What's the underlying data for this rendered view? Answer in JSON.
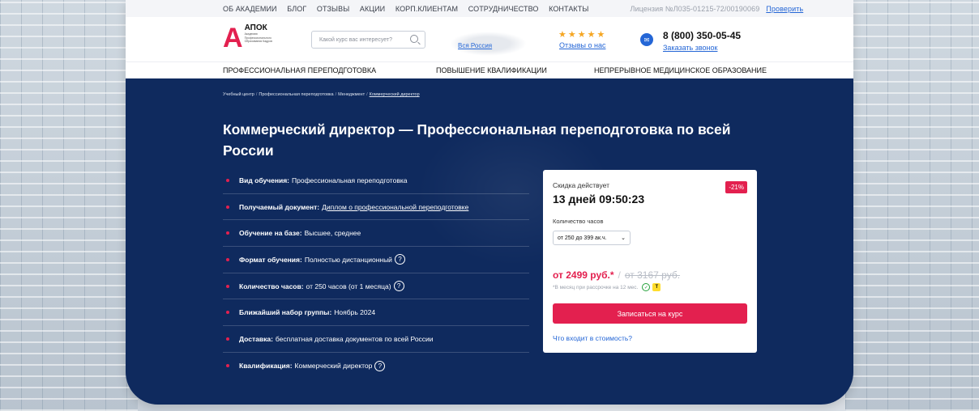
{
  "topbar": {
    "nav": [
      "ОБ АКАДЕМИИ",
      "БЛОГ",
      "ОТЗЫВЫ",
      "АКЦИИ",
      "КОРП.КЛИЕНТАМ",
      "СОТРУДНИЧЕСТВО",
      "КОНТАКТЫ"
    ],
    "license": "Лицензия №Л035-01215-72/00190069",
    "verify_label": "Проверить"
  },
  "header": {
    "logo_letter": "А",
    "logo_name": "АПОК",
    "logo_sub": "Академия Профессионального Образования Кадров",
    "search_placeholder": "Какой курс вас интересует?",
    "region": "Вся Россия",
    "stars": "★★★★★",
    "reviews_label": "Отзывы о нас",
    "phone": "8 (800) 350-05-45",
    "callback_label": "Заказать звонок"
  },
  "mainnav": {
    "items": [
      "ПРОФЕССИОНАЛЬНАЯ ПЕРЕПОДГОТОВКА",
      "ПОВЫШЕНИЕ КВАЛИФИКАЦИИ",
      "НЕПРЕРЫВНОЕ МЕДИЦИНСКОЕ ОБРАЗОВАНИЕ"
    ]
  },
  "breadcrumb": [
    "Учебный центр",
    "Профессиональная переподготовка",
    "Менеджмент",
    "Коммерческий директор"
  ],
  "title": "Коммерческий директор — Профессиональная переподготовка по всей России",
  "features": [
    {
      "label": "Вид обучения:",
      "value": "Профессиональная переподготовка"
    },
    {
      "label": "Получаемый документ:",
      "value": "Диплом о профессиональной переподготовке"
    },
    {
      "label": "Обучение на базе:",
      "value": "Высшее, среднее"
    },
    {
      "label": "Формат обучения:",
      "value": "Полностью дистанционный"
    },
    {
      "label": "Количество часов:",
      "value": "от 250 часов (от 1 месяца)"
    },
    {
      "label": "Ближайший набор группы:",
      "value": "Ноябрь 2024"
    },
    {
      "label": "Доставка:",
      "value": "бесплатная доставка документов по всей России"
    },
    {
      "label": "Квалификация:",
      "value": "Коммерческий директор"
    }
  ],
  "help_glyph": "?",
  "offer": {
    "discount_label": "Скидка действует",
    "badge": "-21%",
    "timer": "13 дней 09:50:23",
    "hours_label": "Количество часов",
    "hours_selected": "от 250 до 399 ак.ч.",
    "price_new": "от 2499 руб.*",
    "price_sep": "/",
    "price_old": "от 3167 руб.",
    "installment": "*В месяц при рассрочке на 12 мес.",
    "cta": "Записаться на курс",
    "whats_included": "Что входит в стоимость?"
  },
  "colors": {
    "brand": "#e3204f",
    "navy": "#0f2a5e",
    "link": "#2466d6",
    "star": "#f5a623"
  }
}
